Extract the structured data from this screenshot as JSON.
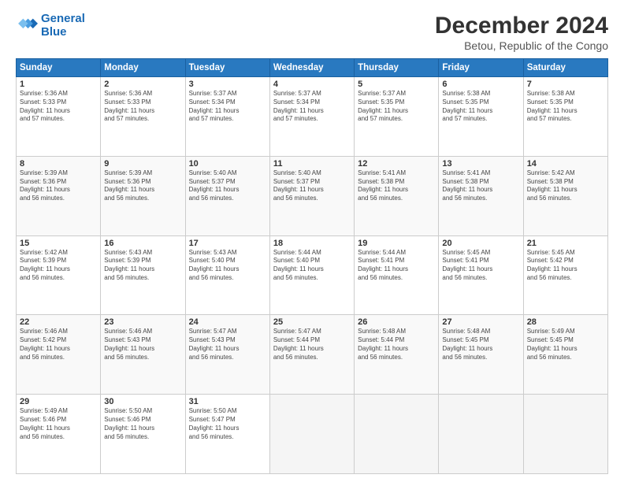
{
  "logo": {
    "line1": "General",
    "line2": "Blue"
  },
  "title": "December 2024",
  "subtitle": "Betou, Republic of the Congo",
  "days_header": [
    "Sunday",
    "Monday",
    "Tuesday",
    "Wednesday",
    "Thursday",
    "Friday",
    "Saturday"
  ],
  "weeks": [
    [
      {
        "num": "1",
        "info": "Sunrise: 5:36 AM\nSunset: 5:33 PM\nDaylight: 11 hours\nand 57 minutes."
      },
      {
        "num": "2",
        "info": "Sunrise: 5:36 AM\nSunset: 5:33 PM\nDaylight: 11 hours\nand 57 minutes."
      },
      {
        "num": "3",
        "info": "Sunrise: 5:37 AM\nSunset: 5:34 PM\nDaylight: 11 hours\nand 57 minutes."
      },
      {
        "num": "4",
        "info": "Sunrise: 5:37 AM\nSunset: 5:34 PM\nDaylight: 11 hours\nand 57 minutes."
      },
      {
        "num": "5",
        "info": "Sunrise: 5:37 AM\nSunset: 5:35 PM\nDaylight: 11 hours\nand 57 minutes."
      },
      {
        "num": "6",
        "info": "Sunrise: 5:38 AM\nSunset: 5:35 PM\nDaylight: 11 hours\nand 57 minutes."
      },
      {
        "num": "7",
        "info": "Sunrise: 5:38 AM\nSunset: 5:35 PM\nDaylight: 11 hours\nand 57 minutes."
      }
    ],
    [
      {
        "num": "8",
        "info": "Sunrise: 5:39 AM\nSunset: 5:36 PM\nDaylight: 11 hours\nand 56 minutes."
      },
      {
        "num": "9",
        "info": "Sunrise: 5:39 AM\nSunset: 5:36 PM\nDaylight: 11 hours\nand 56 minutes."
      },
      {
        "num": "10",
        "info": "Sunrise: 5:40 AM\nSunset: 5:37 PM\nDaylight: 11 hours\nand 56 minutes."
      },
      {
        "num": "11",
        "info": "Sunrise: 5:40 AM\nSunset: 5:37 PM\nDaylight: 11 hours\nand 56 minutes."
      },
      {
        "num": "12",
        "info": "Sunrise: 5:41 AM\nSunset: 5:38 PM\nDaylight: 11 hours\nand 56 minutes."
      },
      {
        "num": "13",
        "info": "Sunrise: 5:41 AM\nSunset: 5:38 PM\nDaylight: 11 hours\nand 56 minutes."
      },
      {
        "num": "14",
        "info": "Sunrise: 5:42 AM\nSunset: 5:38 PM\nDaylight: 11 hours\nand 56 minutes."
      }
    ],
    [
      {
        "num": "15",
        "info": "Sunrise: 5:42 AM\nSunset: 5:39 PM\nDaylight: 11 hours\nand 56 minutes."
      },
      {
        "num": "16",
        "info": "Sunrise: 5:43 AM\nSunset: 5:39 PM\nDaylight: 11 hours\nand 56 minutes."
      },
      {
        "num": "17",
        "info": "Sunrise: 5:43 AM\nSunset: 5:40 PM\nDaylight: 11 hours\nand 56 minutes."
      },
      {
        "num": "18",
        "info": "Sunrise: 5:44 AM\nSunset: 5:40 PM\nDaylight: 11 hours\nand 56 minutes."
      },
      {
        "num": "19",
        "info": "Sunrise: 5:44 AM\nSunset: 5:41 PM\nDaylight: 11 hours\nand 56 minutes."
      },
      {
        "num": "20",
        "info": "Sunrise: 5:45 AM\nSunset: 5:41 PM\nDaylight: 11 hours\nand 56 minutes."
      },
      {
        "num": "21",
        "info": "Sunrise: 5:45 AM\nSunset: 5:42 PM\nDaylight: 11 hours\nand 56 minutes."
      }
    ],
    [
      {
        "num": "22",
        "info": "Sunrise: 5:46 AM\nSunset: 5:42 PM\nDaylight: 11 hours\nand 56 minutes."
      },
      {
        "num": "23",
        "info": "Sunrise: 5:46 AM\nSunset: 5:43 PM\nDaylight: 11 hours\nand 56 minutes."
      },
      {
        "num": "24",
        "info": "Sunrise: 5:47 AM\nSunset: 5:43 PM\nDaylight: 11 hours\nand 56 minutes."
      },
      {
        "num": "25",
        "info": "Sunrise: 5:47 AM\nSunset: 5:44 PM\nDaylight: 11 hours\nand 56 minutes."
      },
      {
        "num": "26",
        "info": "Sunrise: 5:48 AM\nSunset: 5:44 PM\nDaylight: 11 hours\nand 56 minutes."
      },
      {
        "num": "27",
        "info": "Sunrise: 5:48 AM\nSunset: 5:45 PM\nDaylight: 11 hours\nand 56 minutes."
      },
      {
        "num": "28",
        "info": "Sunrise: 5:49 AM\nSunset: 5:45 PM\nDaylight: 11 hours\nand 56 minutes."
      }
    ],
    [
      {
        "num": "29",
        "info": "Sunrise: 5:49 AM\nSunset: 5:46 PM\nDaylight: 11 hours\nand 56 minutes."
      },
      {
        "num": "30",
        "info": "Sunrise: 5:50 AM\nSunset: 5:46 PM\nDaylight: 11 hours\nand 56 minutes."
      },
      {
        "num": "31",
        "info": "Sunrise: 5:50 AM\nSunset: 5:47 PM\nDaylight: 11 hours\nand 56 minutes."
      },
      {
        "num": "",
        "info": ""
      },
      {
        "num": "",
        "info": ""
      },
      {
        "num": "",
        "info": ""
      },
      {
        "num": "",
        "info": ""
      }
    ]
  ]
}
